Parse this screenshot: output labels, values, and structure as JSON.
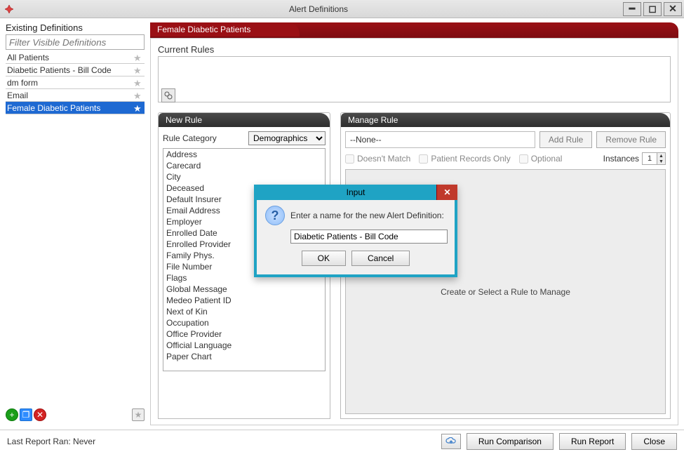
{
  "window": {
    "title": "Alert Definitions"
  },
  "sidebar": {
    "heading": "Existing Definitions",
    "filter_placeholder": "Filter Visible Definitions",
    "items": [
      {
        "label": "All Patients",
        "selected": false
      },
      {
        "label": "Diabetic Patients - Bill Code",
        "selected": false
      },
      {
        "label": "dm form",
        "selected": false
      },
      {
        "label": "Email",
        "selected": false
      },
      {
        "label": "Female Diabetic Patients",
        "selected": true
      }
    ]
  },
  "panel": {
    "title": "Female Diabetic Patients",
    "current_rules_label": "Current Rules"
  },
  "new_rule": {
    "heading": "New Rule",
    "category_label": "Rule Category",
    "category_value": "Demographics",
    "rules": [
      "Address",
      "Carecard",
      "City",
      "Deceased",
      "Default Insurer",
      "Email Address",
      "Employer",
      "Enrolled Date",
      "Enrolled Provider",
      "Family Phys.",
      "File Number",
      "Flags",
      "Global Message",
      "Medeo Patient ID",
      "Next of Kin",
      "Occupation",
      "Office Provider",
      "Official Language",
      "Paper Chart"
    ]
  },
  "manage_rule": {
    "heading": "Manage Rule",
    "selected": "--None--",
    "add_label": "Add Rule",
    "remove_label": "Remove Rule",
    "doesnt_match_label": "Doesn't Match",
    "patient_records_label": "Patient Records Only",
    "optional_label": "Optional",
    "instances_label": "Instances",
    "instances_value": "1",
    "placeholder_text": "Create or Select a Rule to Manage"
  },
  "modal": {
    "title": "Input",
    "prompt": "Enter a name for the new Alert Definition:",
    "value": "Diabetic Patients - Bill Code",
    "ok": "OK",
    "cancel": "Cancel"
  },
  "footer": {
    "status": "Last Report Ran: Never",
    "run_comparison": "Run Comparison",
    "run_report": "Run Report",
    "close": "Close"
  }
}
